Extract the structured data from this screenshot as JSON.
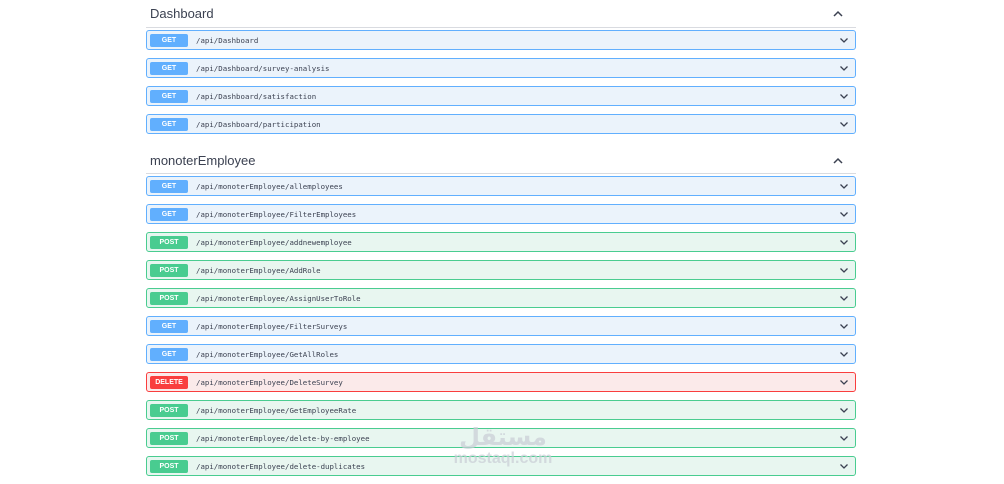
{
  "sections": [
    {
      "title": "Dashboard",
      "operations": [
        {
          "method": "GET",
          "path": "/api/Dashboard"
        },
        {
          "method": "GET",
          "path": "/api/Dashboard/survey-analysis"
        },
        {
          "method": "GET",
          "path": "/api/Dashboard/satisfaction"
        },
        {
          "method": "GET",
          "path": "/api/Dashboard/participation"
        }
      ]
    },
    {
      "title": "monoterEmployee",
      "operations": [
        {
          "method": "GET",
          "path": "/api/monoterEmployee/allemployees"
        },
        {
          "method": "GET",
          "path": "/api/monoterEmployee/FilterEmployees"
        },
        {
          "method": "POST",
          "path": "/api/monoterEmployee/addnewemployee"
        },
        {
          "method": "POST",
          "path": "/api/monoterEmployee/AddRole"
        },
        {
          "method": "POST",
          "path": "/api/monoterEmployee/AssignUserToRole"
        },
        {
          "method": "GET",
          "path": "/api/monoterEmployee/FilterSurveys"
        },
        {
          "method": "GET",
          "path": "/api/monoterEmployee/GetAllRoles"
        },
        {
          "method": "DELETE",
          "path": "/api/monoterEmployee/DeleteSurvey"
        },
        {
          "method": "POST",
          "path": "/api/monoterEmployee/GetEmployeeRate"
        },
        {
          "method": "POST",
          "path": "/api/monoterEmployee/delete-by-employee"
        },
        {
          "method": "POST",
          "path": "/api/monoterEmployee/delete-duplicates"
        }
      ]
    }
  ],
  "watermark": {
    "logo": "مستقل",
    "text": "mostaql.com"
  },
  "colors": {
    "get": "#61affe",
    "post": "#49cc90",
    "delete": "#f93e3e"
  },
  "icons": {
    "section_toggle": "chevron-up-icon",
    "operation_toggle": "chevron-down-icon"
  }
}
